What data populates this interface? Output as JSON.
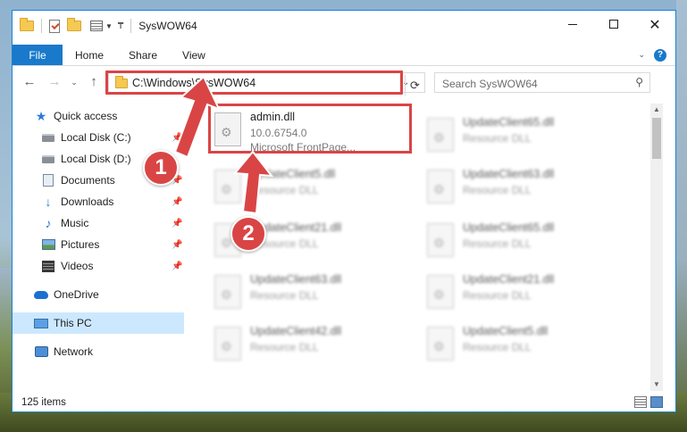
{
  "window": {
    "title": "SysWOW64",
    "controls": {
      "minimize": "minimize",
      "maximize": "maximize",
      "close": "✕"
    }
  },
  "ribbon": {
    "file_tab": "File",
    "tabs": [
      "Home",
      "Share",
      "View"
    ],
    "help": "?"
  },
  "address": {
    "path": "C:\\Windows\\SysWOW64",
    "search_placeholder": "Search SysWOW64"
  },
  "sidebar": {
    "items": [
      {
        "label": "Quick access",
        "icon": "star-icon",
        "pinned": false
      },
      {
        "label": "Local Disk (C:)",
        "icon": "drive-icon",
        "pinned": true
      },
      {
        "label": "Local Disk (D:)",
        "icon": "drive-icon",
        "pinned": false
      },
      {
        "label": "Documents",
        "icon": "documents-icon",
        "pinned": true
      },
      {
        "label": "Downloads",
        "icon": "download-icon",
        "pinned": true
      },
      {
        "label": "Music",
        "icon": "music-icon",
        "pinned": true
      },
      {
        "label": "Pictures",
        "icon": "pictures-icon",
        "pinned": true
      },
      {
        "label": "Videos",
        "icon": "videos-icon",
        "pinned": true
      },
      {
        "label": "OneDrive",
        "icon": "onedrive-icon",
        "pinned": false
      },
      {
        "label": "This PC",
        "icon": "this-pc-icon",
        "pinned": false,
        "selected": true
      },
      {
        "label": "Network",
        "icon": "network-icon",
        "pinned": false
      }
    ],
    "pin_glyph": "📌"
  },
  "files": {
    "highlighted": {
      "name": "admin.dll",
      "version": "10.0.6754.0",
      "description": "Microsoft FrontPage..."
    },
    "column1": [
      {
        "name": "UpdateClient5.dll",
        "type": "Resource DLL"
      },
      {
        "name": "UpdateClient21.dll",
        "type": "Resource DLL"
      },
      {
        "name": "UpdateClient63.dll",
        "type": "Resource DLL"
      },
      {
        "name": "UpdateClient42.dll",
        "type": "Resource DLL"
      }
    ],
    "column2": [
      {
        "name": "UpdateClient65.dll",
        "type": "Resource DLL"
      },
      {
        "name": "UpdateClient63.dll",
        "type": "Resource DLL"
      },
      {
        "name": "UpdateClient65.dll",
        "type": "Resource DLL"
      },
      {
        "name": "UpdateClient21.dll",
        "type": "Resource DLL"
      },
      {
        "name": "UpdateClient5.dll",
        "type": "Resource DLL"
      }
    ]
  },
  "status": {
    "item_count": "125 items"
  },
  "annotations": {
    "step1": "1",
    "step2": "2",
    "color": "#d94545"
  }
}
